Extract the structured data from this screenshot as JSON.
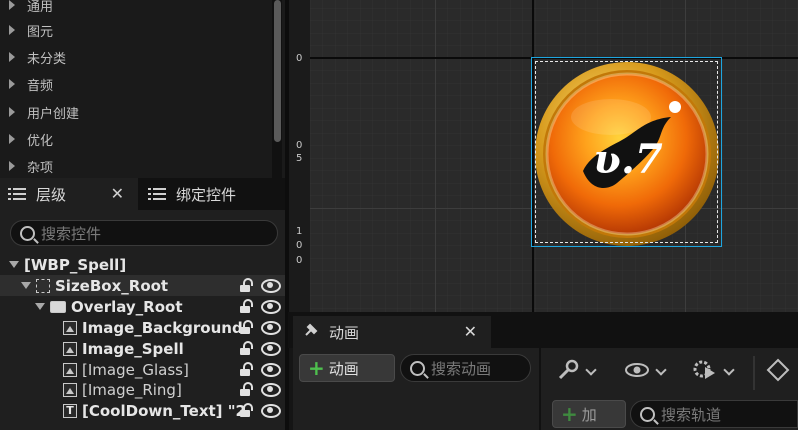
{
  "palette": {
    "categories": [
      "通用",
      "图元",
      "未分类",
      "音频",
      "用户创建",
      "优化",
      "杂项"
    ]
  },
  "hierarchy_panel": {
    "tab_label": "层级",
    "close_glyph": "✕",
    "bind_tab_label": "绑定控件",
    "search_placeholder": "搜索控件",
    "tree": [
      {
        "label": "[WBP_Spell]"
      },
      {
        "label": "SizeBox_Root"
      },
      {
        "label": "Overlay_Root"
      },
      {
        "label": "Image_Background"
      },
      {
        "label": "Image_Spell"
      },
      {
        "label": "[Image_Glass]"
      },
      {
        "label": "[Image_Ring]"
      },
      {
        "label": "[CoolDown_Text] \"2"
      }
    ]
  },
  "designer": {
    "ruler_marks": [
      "0",
      "5",
      "0",
      "1",
      "0",
      "0"
    ],
    "ruler_top_label": "0",
    "widget_glyph": "ʋ.7"
  },
  "animations_panel": {
    "tab_label": "动画",
    "close_glyph": "✕",
    "add_animation_label": "动画",
    "search_animation_placeholder": "搜索动画",
    "add_track_label": "加",
    "search_track_placeholder": "搜索轨道"
  },
  "colors": {
    "selection_outline": "#1ea6e0",
    "add_green": "#4ec04e",
    "ring_gold": "#d79a1c",
    "fire_orange": "#f07a10"
  }
}
